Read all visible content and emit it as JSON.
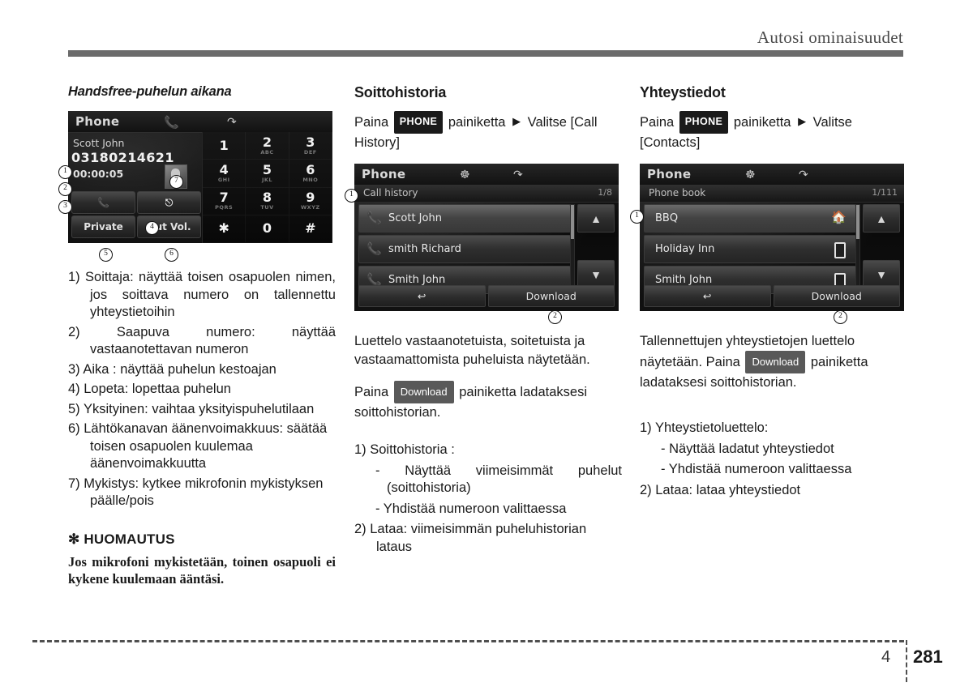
{
  "header": {
    "title": "Autosi ominaisuudet"
  },
  "footer": {
    "chapter": "4",
    "page": "281"
  },
  "columns": {
    "left": {
      "heading": "Handsfree-puhelun aikana",
      "device": {
        "title": "Phone",
        "icons": {
          "call": "call-icon",
          "usb": "usb-icon"
        },
        "caller_name": "Scott John",
        "caller_number": "03180214621",
        "call_duration": "00:00:05",
        "buttons": {
          "private": "Private",
          "out_vol": "Out Vol."
        },
        "keypad": [
          {
            "digit": "1",
            "letters": ""
          },
          {
            "digit": "2",
            "letters": "ABC"
          },
          {
            "digit": "3",
            "letters": "DEF"
          },
          {
            "digit": "4",
            "letters": "GHI"
          },
          {
            "digit": "5",
            "letters": "JKL"
          },
          {
            "digit": "6",
            "letters": "MNO"
          },
          {
            "digit": "7",
            "letters": "PQRS"
          },
          {
            "digit": "8",
            "letters": "TUV"
          },
          {
            "digit": "9",
            "letters": "WXYZ"
          },
          {
            "digit": "✱",
            "letters": ""
          },
          {
            "digit": "0",
            "letters": ""
          },
          {
            "digit": "#",
            "letters": ""
          }
        ],
        "callouts": [
          "1",
          "2",
          "3",
          "4",
          "5",
          "6",
          "7"
        ]
      },
      "items": [
        "1) Soittaja: näyttää toisen osapuolen nimen, jos soittava numero on tallennettu yhteystietoihin",
        "2) Saapuva numero: näyttää vastaanotettavan numeron",
        "3) Aika : näyttää puhelun kestoajan",
        "4) Lopeta: lopettaa puhelun",
        "5) Yksityinen: vaihtaa yksityispuhelutilaan",
        "6) Lähtökanavan äänenvoimakkuus: säätää toisen osapuolen kuulemaa äänenvoimakkuutta",
        "7) Mykistys: kytkee mikrofonin mykistyksen päälle/pois"
      ],
      "note": {
        "heading": "✻ HUOMAUTUS",
        "body": "Jos mikrofoni mykistetään, toinen osapuoli ei kykene kuulemaan ääntäsi."
      }
    },
    "middle": {
      "heading": "Soittohistoria",
      "lead": {
        "before": "Paina",
        "key": "PHONE",
        "middle": "painiketta",
        "arrow": "▶",
        "after": "Valitse [Call History]"
      },
      "device": {
        "title": "Phone",
        "list_title": "Call history",
        "count": "1/8",
        "rows": [
          {
            "label": "Scott John",
            "icon": "call-outgoing-icon"
          },
          {
            "label": "smith Richard",
            "icon": "call-incoming-icon"
          },
          {
            "label": "Smith John",
            "icon": "call-incoming-icon"
          }
        ],
        "back_label": "",
        "download_label": "Download",
        "callouts": [
          "1",
          "2"
        ]
      },
      "paragraphs": [
        "Luettelo vastaanotetuista, soitetuista ja vastaamattomista puheluista näytetään.",
        "Paina |Download| painiketta ladataksesi soittohistorian."
      ],
      "download_chip": "Download",
      "para2_before": "Paina",
      "para2_after": "painiketta ladataksesi soittohistorian.",
      "items": [
        "1) Soittohistoria :",
        "- Näyttää viimeisimmät puhelut (soittohistoria)",
        "- Yhdistää numeroon valittaessa",
        "2) Lataa: viimeisimmän puheluhistorian lataus"
      ]
    },
    "right": {
      "heading": "Yhteystiedot",
      "lead": {
        "before": "Paina",
        "key": "PHONE",
        "middle": "painiketta",
        "arrow": "▶",
        "after": "Valitse [Contacts]"
      },
      "device": {
        "title": "Phone",
        "list_title": "Phone book",
        "count": "1/111",
        "rows": [
          {
            "label": "BBQ",
            "right_icon": "home-icon"
          },
          {
            "label": "Holiday Inn",
            "right_icon": "mobile-icon"
          },
          {
            "label": "Smith John",
            "right_icon": "mobile-icon"
          }
        ],
        "back_label": "",
        "download_label": "Download",
        "callouts": [
          "1",
          "2"
        ]
      },
      "para_before": "Tallennettujen yhteystietojen luettelo näytetään. Paina",
      "download_chip": "Download",
      "para_after": "painiketta ladataksesi soittohistorian.",
      "items": [
        "1) Yhteystietoluettelo:",
        "- Näyttää ladatut yhteystiedot",
        "- Yhdistää numeroon valittaessa",
        "2) Lataa: lataa yhteystiedot"
      ]
    }
  }
}
